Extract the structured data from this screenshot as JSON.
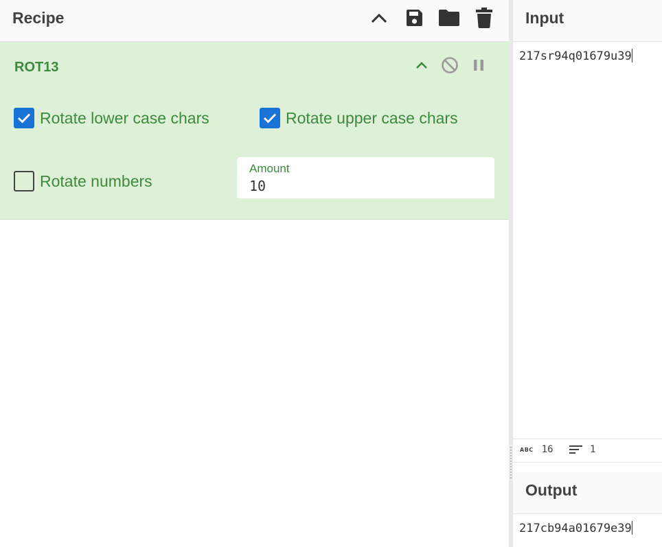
{
  "recipe": {
    "title": "Recipe",
    "header_icons": [
      "chevron-up-icon",
      "save-icon",
      "folder-icon",
      "trash-icon"
    ],
    "operation": {
      "name": "ROT13",
      "controls": [
        "chevron-up-icon",
        "disable-icon",
        "pause-icon"
      ],
      "options": {
        "rotate_lower": {
          "label": "Rotate lower case chars",
          "checked": true
        },
        "rotate_upper": {
          "label": "Rotate upper case chars",
          "checked": true
        },
        "rotate_numbers": {
          "label": "Rotate numbers",
          "checked": false
        }
      },
      "amount": {
        "label": "Amount",
        "value": "10"
      }
    }
  },
  "input": {
    "title": "Input",
    "text": "217sr94q01679u39",
    "status": {
      "length": "16",
      "lines": "1"
    }
  },
  "output": {
    "title": "Output",
    "text": "217cb94a01679e39"
  },
  "colors": {
    "accent_blue": "#1a73d6",
    "op_green_bg": "#dff0d8",
    "op_green_text": "#3c8a3c",
    "header_text": "#424242"
  }
}
